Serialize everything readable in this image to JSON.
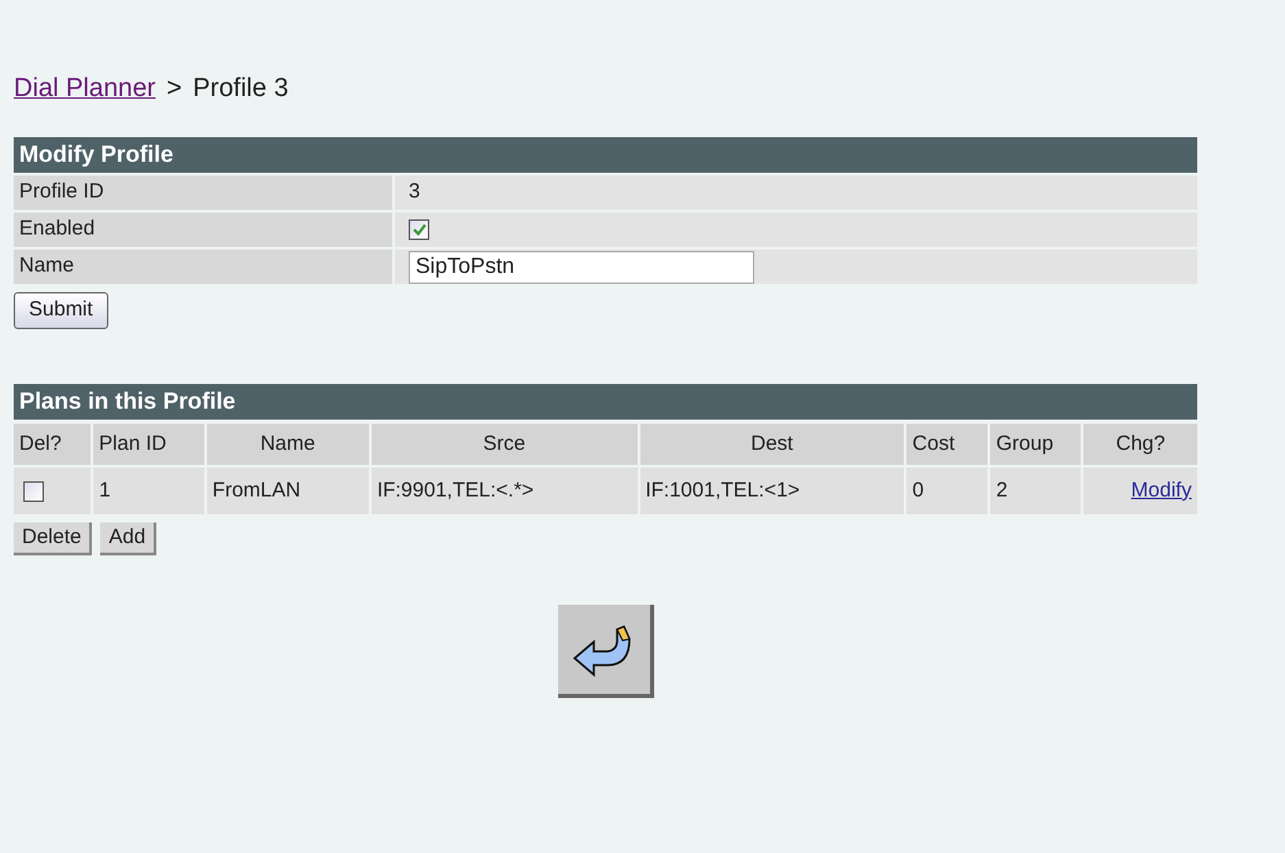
{
  "breadcrumb": {
    "link": "Dial Planner",
    "separator": ">",
    "current": "Profile 3"
  },
  "modify_profile": {
    "title": "Modify Profile",
    "rows": [
      {
        "kind": "text",
        "label": "Profile ID",
        "value": "3"
      },
      {
        "kind": "checkbox",
        "label": "Enabled",
        "checked": true
      },
      {
        "kind": "input",
        "label": "Name",
        "value": "SipToPstn"
      }
    ],
    "submit": "Submit"
  },
  "plans": {
    "title": "Plans in this Profile",
    "columns": [
      "Del?",
      "Plan ID",
      "Name",
      "Srce",
      "Dest",
      "Cost",
      "Group",
      "Chg?"
    ],
    "rows": [
      {
        "checked": false,
        "plan_id": "1",
        "name": "FromLAN",
        "srce": "IF:9901,TEL:<.*>",
        "dest": "IF:1001,TEL:<1>",
        "cost": "0",
        "group": "2",
        "link": "Modify"
      }
    ],
    "buttons": [
      "Delete",
      "Add"
    ]
  }
}
